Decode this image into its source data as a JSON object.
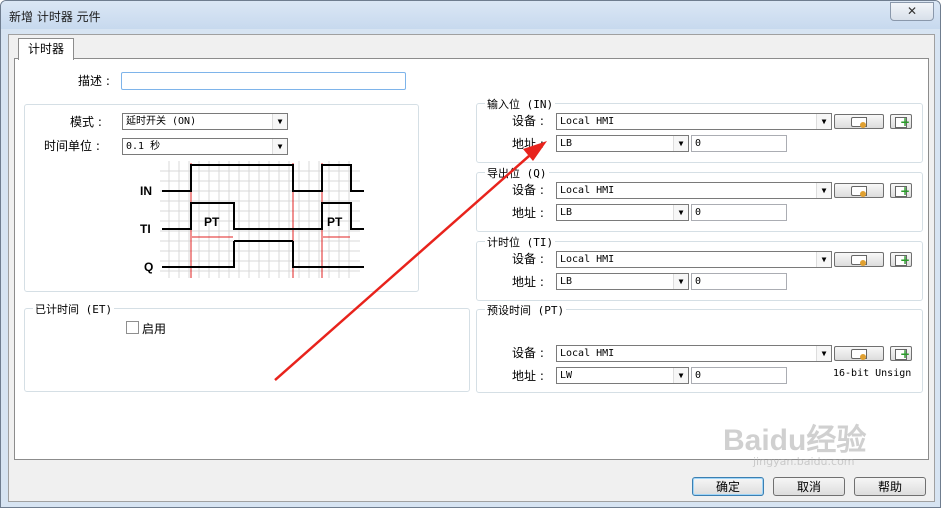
{
  "window": {
    "title": "新增 计时器 元件",
    "close_glyph": "✕"
  },
  "tab": {
    "label": "计时器"
  },
  "description": {
    "label": "描述 :",
    "value": ""
  },
  "mode": {
    "mode_label": "模式 :",
    "mode_value": "延时开关 (ON)",
    "unit_label": "时间单位 :",
    "unit_value": "0.1  秒"
  },
  "diagram": {
    "labels": [
      "IN",
      "TI",
      "Q"
    ],
    "pt_label": "PT"
  },
  "elapsed": {
    "title": "已计时间 (ET)",
    "enable_label": "启用",
    "enabled": false
  },
  "io_groups": [
    {
      "title": "输入位 (IN)",
      "device_label": "设备 :",
      "device_value": "Local HMI",
      "address_label": "地址 :",
      "address_type": "LB",
      "address_value": "0",
      "extra": ""
    },
    {
      "title": "导出位 (Q)",
      "device_label": "设备 :",
      "device_value": "Local HMI",
      "address_label": "地址 :",
      "address_type": "LB",
      "address_value": "0",
      "extra": ""
    },
    {
      "title": "计时位 (TI)",
      "device_label": "设备 :",
      "device_value": "Local HMI",
      "address_label": "地址 :",
      "address_type": "LB",
      "address_value": "0",
      "extra": ""
    },
    {
      "title": "预设时间 (PT)",
      "device_label": "设备 :",
      "device_value": "Local HMI",
      "address_label": "地址 :",
      "address_type": "LW",
      "address_value": "0",
      "extra": "16-bit Unsign"
    }
  ],
  "buttons": {
    "ok": "确定",
    "cancel": "取消",
    "help": "帮助"
  },
  "watermark": {
    "text": "Baidu经验",
    "url": "jingyan.baidu.com"
  },
  "colors": {
    "annotation_arrow": "#e8231c",
    "group_border": "#d5dfe5",
    "timing_red": "#e02020"
  }
}
